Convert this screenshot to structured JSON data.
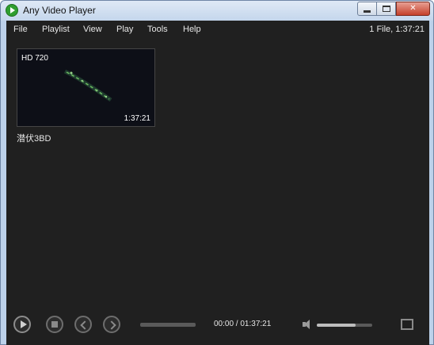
{
  "window": {
    "title": "Any Video Player"
  },
  "menu": {
    "items": [
      "File",
      "Playlist",
      "View",
      "Play",
      "Tools",
      "Help"
    ],
    "file_info": "1 File, 1:37:21"
  },
  "playlist": {
    "items": [
      {
        "quality": "HD 720",
        "duration": "1:37:21",
        "title": "潜伏3BD"
      }
    ]
  },
  "player": {
    "time_display": "00:00 / 01:37:21",
    "progress": 0.0,
    "volume": 0.7
  },
  "colors": {
    "background": "#202020",
    "text": "#e6e6e6",
    "window_frame": "#bcd1ea",
    "close_button": "#c5402b"
  },
  "icons": {
    "app": "play-circle-icon",
    "play": "play-icon",
    "stop": "stop-icon",
    "prev": "previous-icon",
    "next": "next-icon",
    "volume": "speaker-icon",
    "fullscreen": "fullscreen-icon"
  }
}
